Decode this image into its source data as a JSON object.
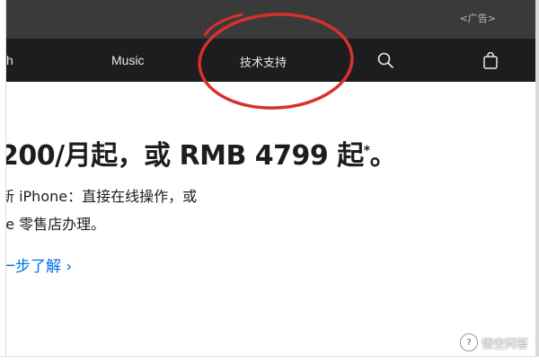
{
  "ad": {
    "label": "<广告>"
  },
  "nav": {
    "items": [
      {
        "label": "ch"
      },
      {
        "label": "Music"
      },
      {
        "label": "技术支持"
      }
    ],
    "icons": {
      "search": "search-icon",
      "bag": "bag-icon"
    }
  },
  "hero": {
    "headline": "200/月起，或 RMB 4799 起",
    "headline_mark": "*",
    "headline_end": "。",
    "line1": "新 iPhone：直接在线操作，或",
    "line2": "re 零售店办理。",
    "learn_more": "一步了解 ›"
  },
  "watermark": {
    "text": "悟空问答"
  },
  "colors": {
    "nav_bg": "#1d1d1f",
    "ad_bg": "#3a3a3a",
    "link": "#0071e3",
    "annotation": "#d9302c"
  }
}
